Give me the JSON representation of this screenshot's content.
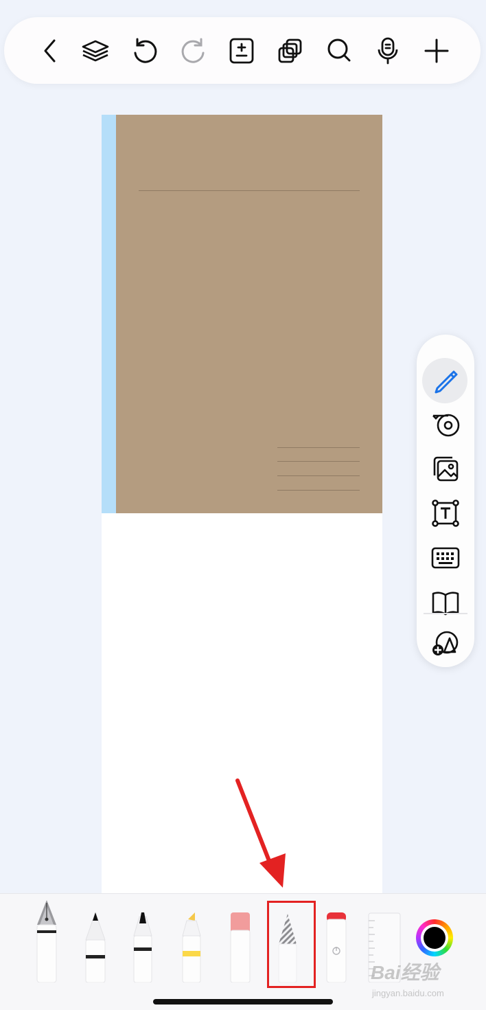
{
  "top_toolbar": {
    "icons": [
      "back-chevron-icon",
      "layers-icon",
      "undo-icon",
      "redo-icon",
      "page-add-icon",
      "duplicate-icon",
      "search-icon",
      "microphone-icon",
      "plus-icon"
    ]
  },
  "side_palette": {
    "tools": [
      "pencil-icon",
      "tape-icon",
      "image-icon",
      "text-box-icon",
      "keyboard-icon",
      "book-icon",
      "shape-add-icon"
    ],
    "active_tool": "pencil-icon"
  },
  "bottom_tray": {
    "tools": [
      "fountain-pen",
      "ballpoint-pen",
      "marker-pen",
      "highlighter",
      "eraser",
      "pattern-pencil",
      "laser-pointer",
      "ruler"
    ],
    "selected_tool": "pattern-pencil",
    "current_color": "#000000",
    "highlight_color": "#e32222"
  },
  "notebook": {
    "cover_color": "#b49c80",
    "spine_color": "#b5def9"
  },
  "watermark": {
    "main": "Bai经验",
    "sub": "jingyan.baidu.com"
  }
}
